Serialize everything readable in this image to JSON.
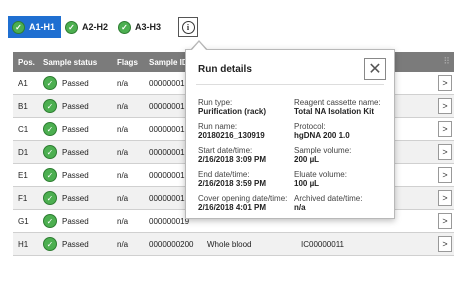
{
  "tabs": [
    {
      "label": "A1-H1",
      "active": true
    },
    {
      "label": "A2-H2",
      "active": false
    },
    {
      "label": "A3-H3",
      "active": false
    }
  ],
  "info_button": {
    "glyph": "i",
    "icon": "info-icon"
  },
  "table": {
    "headers": [
      "Pos.",
      "Sample status",
      "Flags",
      "Sample ID"
    ],
    "rows": [
      {
        "pos": "A1",
        "status": "Passed",
        "flags": "n/a",
        "sid": "000000019",
        "stype": "",
        "reg": ""
      },
      {
        "pos": "B1",
        "status": "Passed",
        "flags": "n/a",
        "sid": "000000019",
        "stype": "",
        "reg": ""
      },
      {
        "pos": "C1",
        "status": "Passed",
        "flags": "n/a",
        "sid": "000000019",
        "stype": "",
        "reg": ""
      },
      {
        "pos": "D1",
        "status": "Passed",
        "flags": "n/a",
        "sid": "000000019",
        "stype": "",
        "reg": ""
      },
      {
        "pos": "E1",
        "status": "Passed",
        "flags": "n/a",
        "sid": "000000019",
        "stype": "",
        "reg": ""
      },
      {
        "pos": "F1",
        "status": "Passed",
        "flags": "n/a",
        "sid": "000000019",
        "stype": "",
        "reg": ""
      },
      {
        "pos": "G1",
        "status": "Passed",
        "flags": "n/a",
        "sid": "000000019",
        "stype": "",
        "reg": ""
      },
      {
        "pos": "H1",
        "status": "Passed",
        "flags": "n/a",
        "sid": "0000000200",
        "stype": "Whole blood",
        "reg": "IC00000011"
      }
    ],
    "row_button_glyph": ">"
  },
  "popup": {
    "title": "Run details",
    "close_glyph": "✕",
    "fields": {
      "run_type_label": "Run type:",
      "run_type_value": "Purification (rack)",
      "run_name_label": "Run name:",
      "run_name_value": "20180216_130919",
      "start_label": "Start date/time:",
      "start_value": "2/16/2018 3:09 PM",
      "end_label": "End date/time:",
      "end_value": "2/16/2018 3:59 PM",
      "cover_label": "Cover opening date/time:",
      "cover_value": "2/16/2018 4:01 PM",
      "reagent_label": "Reagent cassette name:",
      "reagent_value": "Total NA Isolation Kit",
      "protocol_label": "Protocol:",
      "protocol_value": "hgDNA 200 1.0",
      "sample_vol_label": "Sample volume:",
      "sample_vol_value": "200 µL",
      "eluate_vol_label": "Eluate volume:",
      "eluate_vol_value": "100 µL",
      "archived_label": "Archived date/time:",
      "archived_value": "n/a"
    }
  },
  "colors": {
    "active_tab": "#1f6fd1",
    "header": "#7b7b7b",
    "passed": "#4caf50"
  }
}
